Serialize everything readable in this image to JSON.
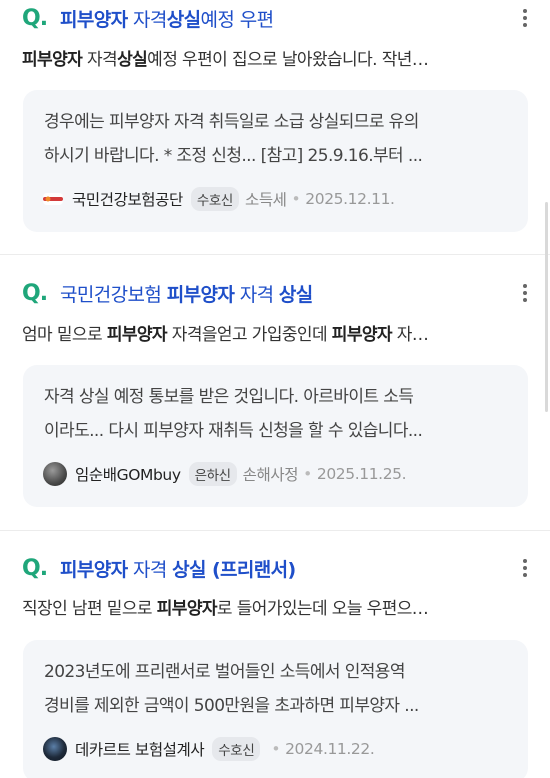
{
  "results": [
    {
      "title_parts": [
        {
          "t": "피부양자",
          "b": true
        },
        {
          "t": " 자격",
          "b": false
        },
        {
          "t": "상실",
          "b": true
        },
        {
          "t": "예정 우편",
          "b": false
        }
      ],
      "snippet_parts": [
        {
          "t": "피부양자",
          "b": true
        },
        {
          "t": " 자격",
          "b": false
        },
        {
          "t": "상실",
          "b": true
        },
        {
          "t": "예정 우편이 집으로 날아왔습니다. 작년…",
          "b": false
        }
      ],
      "reply_lines": [
        "경우에는 피부양자 자격 취득일로 소급 상실되므로 유의",
        "하시기 바랍니다. * 조정 신청... [참고] 25.9.16.부터 ..."
      ],
      "author": "국민건강보험공단",
      "badge": "수호신",
      "category": "소득세",
      "date": "2025.12.11.",
      "avatar_color": "#d33a3a"
    },
    {
      "title_parts": [
        {
          "t": "국민건강보험 ",
          "b": false
        },
        {
          "t": "피부양자",
          "b": true
        },
        {
          "t": " 자격 ",
          "b": false
        },
        {
          "t": "상실",
          "b": true
        }
      ],
      "snippet_parts": [
        {
          "t": "엄마 밑으로 ",
          "b": false
        },
        {
          "t": "피부양자",
          "b": true
        },
        {
          "t": " 자격을얻고 가입중인데 ",
          "b": false
        },
        {
          "t": "피부양자",
          "b": true
        },
        {
          "t": " 자…",
          "b": false
        }
      ],
      "reply_lines": [
        "자격 상실 예정 통보를 받은 것입니다. 아르바이트 소득",
        "이라도... 다시 피부양자 재취득 신청을 할 수 있습니다..."
      ],
      "author": "임순배GOMbuy",
      "badge": "은하신",
      "category": "손해사정",
      "date": "2025.11.25.",
      "avatar_color": "#555555"
    },
    {
      "title_parts": [
        {
          "t": "피부양자",
          "b": true
        },
        {
          "t": " 자격 ",
          "b": false
        },
        {
          "t": "상실",
          "b": true
        },
        {
          "t": " (프리랜서)",
          "b": true
        }
      ],
      "snippet_parts": [
        {
          "t": "직장인 남편 밑으로 ",
          "b": false
        },
        {
          "t": "피부양자",
          "b": true
        },
        {
          "t": "로 들어가있는데 오늘 우편으…",
          "b": false
        }
      ],
      "reply_lines": [
        "2023년도에 프리랜서로 벌어들인 소득에서 인적용역",
        "경비를 제외한 금액이 500만원을 초과하면 피부양자 ..."
      ],
      "author": "데카르트 보험설계사",
      "badge": "수호신",
      "category": "",
      "date": "2024.11.22.",
      "avatar_color": "#1e2a3a"
    }
  ],
  "q_icon_text": "Q.",
  "sep": "•"
}
